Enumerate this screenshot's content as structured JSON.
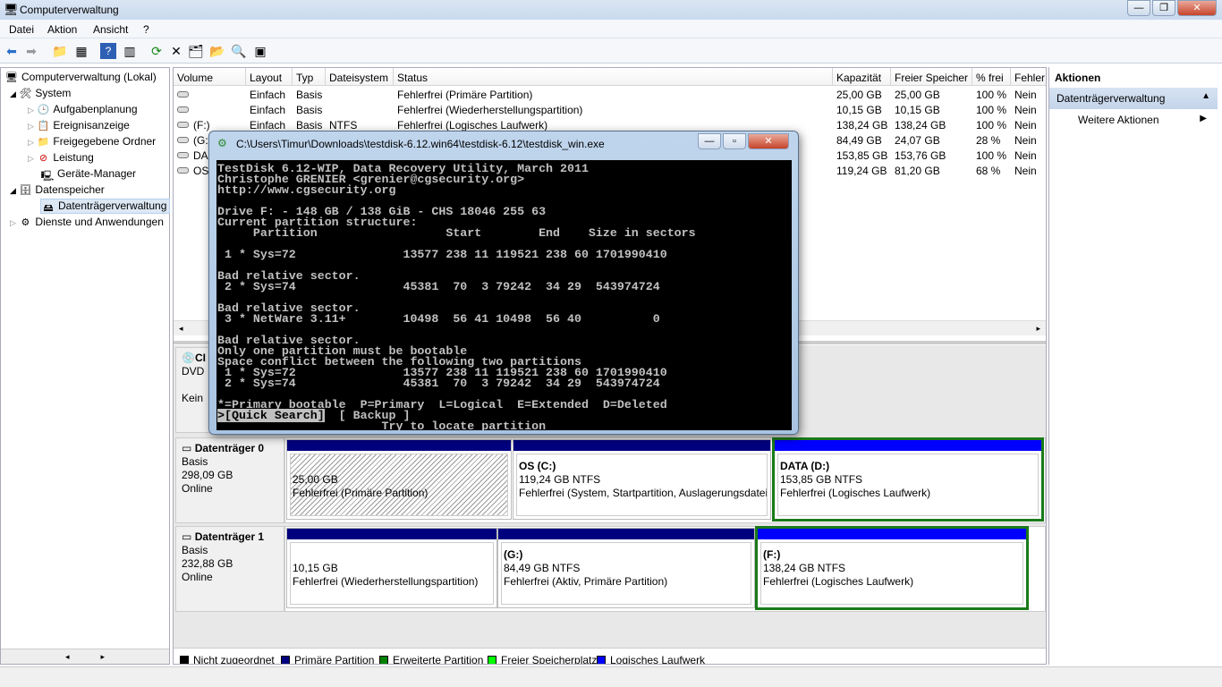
{
  "window": {
    "title": "Computerverwaltung",
    "min": "—",
    "max": "❐",
    "close": "✕"
  },
  "menu": [
    "Datei",
    "Aktion",
    "Ansicht",
    "?"
  ],
  "tree": [
    {
      "label": "Computerverwaltung (Lokal)",
      "icon": "computer-icon"
    },
    {
      "label": "System",
      "icon": "tools-icon"
    },
    {
      "label": "Aufgabenplanung",
      "icon": "clock-icon"
    },
    {
      "label": "Ereignisanzeige",
      "icon": "event-viewer-icon"
    },
    {
      "label": "Freigegebene Ordner",
      "icon": "shared-folder-icon"
    },
    {
      "label": "Leistung",
      "icon": "performance-icon"
    },
    {
      "label": "Geräte-Manager",
      "icon": "device-manager-icon"
    },
    {
      "label": "Datenspeicher",
      "icon": "storage-icon"
    },
    {
      "label": "Datenträgerverwaltung",
      "icon": "disk-management-icon"
    },
    {
      "label": "Dienste und Anwendungen",
      "icon": "services-icon"
    }
  ],
  "table": {
    "columns": [
      "Volume",
      "Layout",
      "Typ",
      "Dateisystem",
      "Status",
      "Kapazität",
      "Freier Speicher",
      "% frei",
      "Fehler"
    ],
    "rows": [
      [
        "",
        "Einfach",
        "Basis",
        "",
        "Fehlerfrei (Primäre Partition)",
        "25,00 GB",
        "25,00 GB",
        "100 %",
        "Nein"
      ],
      [
        "",
        "Einfach",
        "Basis",
        "",
        "Fehlerfrei (Wiederherstellungspartition)",
        "10,15 GB",
        "10,15 GB",
        "100 %",
        "Nein"
      ],
      [
        "(F:)",
        "Einfach",
        "Basis",
        "NTFS",
        "Fehlerfrei (Logisches Laufwerk)",
        "138,24 GB",
        "138,24 GB",
        "100 %",
        "Nein"
      ],
      [
        "(G:",
        "",
        "",
        "",
        "",
        "84,49 GB",
        "24,07 GB",
        "28 %",
        "Nein"
      ],
      [
        "DA",
        "",
        "",
        "",
        "",
        "153,85 GB",
        "153,76 GB",
        "100 %",
        "Nein"
      ],
      [
        "OS",
        "",
        "",
        "",
        "rtition)",
        "119,24 GB",
        "81,20 GB",
        "68 %",
        "Nein"
      ]
    ]
  },
  "cdrom": {
    "name": "CI",
    "type": "DVD",
    "media": "Kein"
  },
  "disks": [
    {
      "name": "Datenträger 0",
      "type": "Basis",
      "size": "298,09 GB",
      "status": "Online",
      "partitions": [
        {
          "title": "",
          "size": "25,00 GB",
          "status": "Fehlerfrei (Primäre Partition)",
          "bar": "#00007f"
        },
        {
          "title": "OS  (C:)",
          "size": "119,24 GB NTFS",
          "status": "Fehlerfrei (System, Startpartition, Auslagerungsdatei,",
          "bar": "#00007f"
        },
        {
          "title": "DATA  (D:)",
          "size": "153,85 GB NTFS",
          "status": "Fehlerfrei (Logisches Laufwerk)",
          "bar": "#0000ff"
        }
      ]
    },
    {
      "name": "Datenträger 1",
      "type": "Basis",
      "size": "232,88 GB",
      "status": "Online",
      "partitions": [
        {
          "title": "",
          "size": "10,15 GB",
          "status": "Fehlerfrei (Wiederherstellungspartition)",
          "bar": "#00007f"
        },
        {
          "title": "(G:)",
          "size": "84,49 GB NTFS",
          "status": "Fehlerfrei (Aktiv, Primäre Partition)",
          "bar": "#00007f"
        },
        {
          "title": "(F:)",
          "size": "138,24 GB NTFS",
          "status": "Fehlerfrei (Logisches Laufwerk)",
          "bar": "#0000ff"
        }
      ]
    }
  ],
  "legend": [
    {
      "label": "Nicht zugeordnet",
      "color": "#000000"
    },
    {
      "label": "Primäre Partition",
      "color": "#00007f"
    },
    {
      "label": "Erweiterte Partition",
      "color": "#008000"
    },
    {
      "label": "Freier Speicherplatz",
      "color": "#00ff00"
    },
    {
      "label": "Logisches Laufwerk",
      "color": "#0000ff"
    }
  ],
  "actions": {
    "header": "Aktionen",
    "section": "Datenträgerverwaltung",
    "item": "Weitere Aktionen"
  },
  "console": {
    "title": "C:\\Users\\Timur\\Downloads\\testdisk-6.12.win64\\testdisk-6.12\\testdisk_win.exe",
    "lines": [
      "TestDisk 6.12-WIP, Data Recovery Utility, March 2011",
      "Christophe GRENIER <grenier@cgsecurity.org>",
      "http://www.cgsecurity.org",
      "",
      "Drive F: - 148 GB / 138 GiB - CHS 18046 255 63",
      "Current partition structure:",
      "     Partition                  Start        End    Size in sectors",
      "",
      " 1 * Sys=72               13577 238 11 119521 238 60 1701990410",
      "",
      "Bad relative sector.",
      " 2 * Sys=74               45381  70  3 79242  34 29  543974724",
      "",
      "Bad relative sector.",
      " 3 * NetWare 3.11+        10498  56 41 10498  56 40          0",
      "",
      "Bad relative sector.",
      "Only one partition must be bootable",
      "Space conflict between the following two partitions",
      " 1 * Sys=72               13577 238 11 119521 238 60 1701990410",
      " 2 * Sys=74               45381  70  3 79242  34 29  543974724",
      "",
      "*=Primary bootable  P=Primary  L=Logical  E=Extended  D=Deleted",
      "",
      "                       Try to locate partition"
    ],
    "menu_selected": ">[Quick Search]",
    "menu_other": "  [ Backup ]"
  }
}
